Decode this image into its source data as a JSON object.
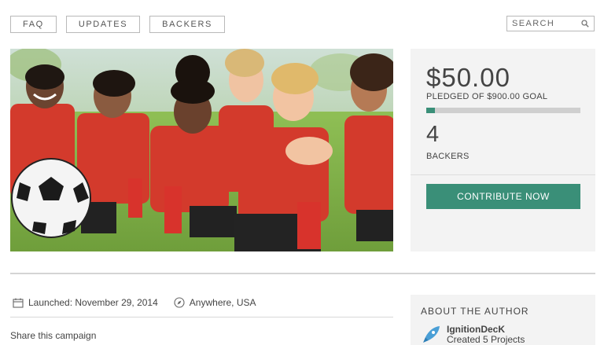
{
  "nav": {
    "items": [
      "FAQ",
      "UPDATES",
      "BACKERS"
    ]
  },
  "search": {
    "placeholder": "SEARCH",
    "icon": "search-icon"
  },
  "campaign": {
    "amount": "$50.00",
    "pledged_text": "PLEDGED OF $900.00 GOAL",
    "progress_fraction": 0.056,
    "backers_count": "4",
    "backers_label": "BACKERS",
    "contribute_label": "CONTRIBUTE NOW"
  },
  "meta": {
    "launched": "Launched: November 29, 2014",
    "location": "Anywhere, USA"
  },
  "share": {
    "label": "Share this campaign"
  },
  "author": {
    "heading": "ABOUT THE AUTHOR",
    "name": "IgnitionDecK",
    "projects": "Created 5 Projects"
  },
  "colors": {
    "accent": "#3a8f78",
    "panel": "#f3f3f3",
    "text": "#444444"
  }
}
